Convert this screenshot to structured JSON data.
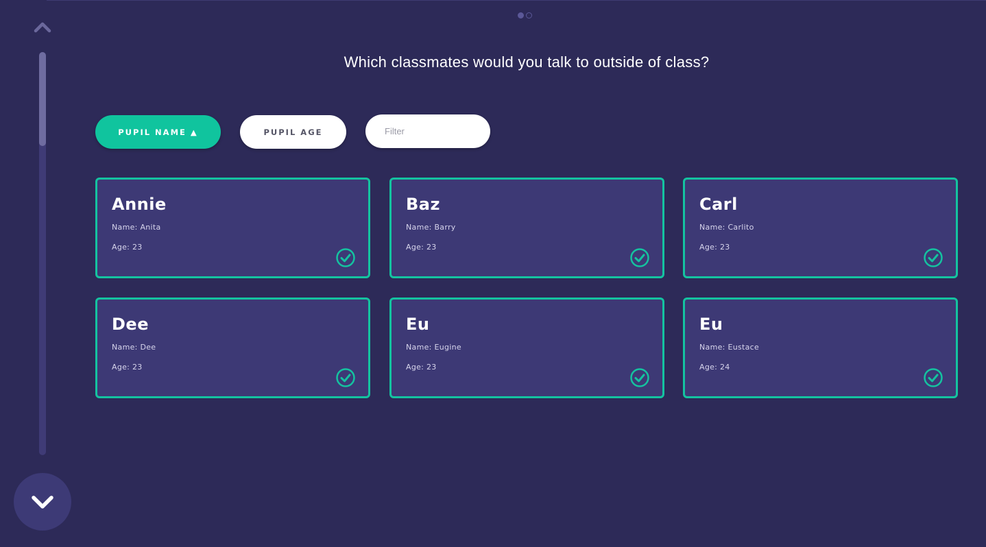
{
  "question": "Which classmates would you talk to outside of class?",
  "sort": {
    "name_label": "PUPIL NAME ▲",
    "age_label": "PUPIL AGE"
  },
  "filter": {
    "placeholder": "Filter",
    "value": ""
  },
  "pager": {
    "total": 2,
    "current": 1
  },
  "colors": {
    "background": "#2d2a58",
    "card": "#3d3975",
    "accent": "#14c3a0"
  },
  "icons": {
    "up": "chevron-up-icon",
    "down": "chevron-down-icon",
    "selected": "check-circle-icon"
  },
  "cards": [
    {
      "nickname": "Annie",
      "name": "Name: Anita",
      "age": "Age: 23",
      "selected": true
    },
    {
      "nickname": "Baz",
      "name": "Name: Barry",
      "age": "Age: 23",
      "selected": true
    },
    {
      "nickname": "Carl",
      "name": "Name: Carlito",
      "age": "Age: 23",
      "selected": true
    },
    {
      "nickname": "Dee",
      "name": "Name: Dee",
      "age": "Age: 23",
      "selected": true
    },
    {
      "nickname": "Eu",
      "name": "Name: Eugine",
      "age": "Age: 23",
      "selected": true
    },
    {
      "nickname": "Eu",
      "name": "Name: Eustace",
      "age": "Age: 24",
      "selected": true
    }
  ]
}
